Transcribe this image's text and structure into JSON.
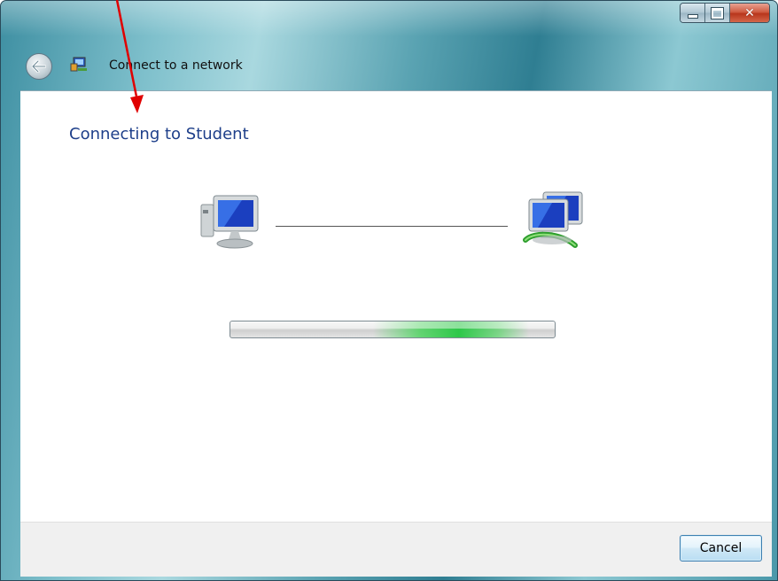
{
  "window": {
    "title": "Connect to a network",
    "controls": {
      "minimize": "minimize-icon",
      "maximize": "maximize-icon",
      "close": "close-icon"
    }
  },
  "content": {
    "heading": "Connecting to Student",
    "icons": {
      "left": "computer-icon",
      "right": "network-icon"
    },
    "progress": {
      "mode": "marquee",
      "accent": "#2ec84a"
    }
  },
  "footer": {
    "cancel_label": "Cancel"
  },
  "annotation": {
    "type": "arrow",
    "color": "#e00000"
  },
  "colors": {
    "heading": "#1e3f8a",
    "frame": "#3e8fa2"
  }
}
